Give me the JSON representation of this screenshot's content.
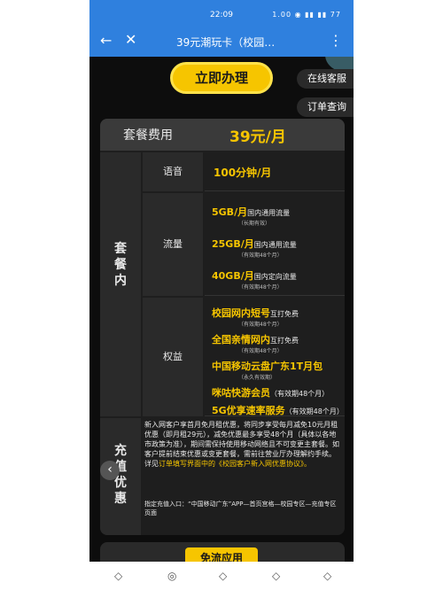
{
  "status_bar": {
    "time": "22:09",
    "icons": "1.00 ◉ ▮▮ ▮▮ 77"
  },
  "nav": {
    "back": "←",
    "close": "✕",
    "title": "39元潮玩卡（校园…",
    "more": "⋮"
  },
  "cta": {
    "label": "立即办理"
  },
  "side": {
    "service": "在线客服",
    "order": "订单查询"
  },
  "fee": {
    "label": "套餐费用",
    "price": "39元/月"
  },
  "package": {
    "label": "套餐内",
    "voice": {
      "label": "语音",
      "value": "100分钟/月"
    },
    "flow": {
      "label": "流量",
      "items": [
        {
          "main": "5GB/月",
          "desc": "国内通用流量",
          "note": "（长期有效）"
        },
        {
          "main": "25GB/月",
          "desc": "国内通用流量",
          "note": "（有效期48个月）"
        },
        {
          "main": "40GB/月",
          "desc": "国内定向流量",
          "note": "（有效期48个月）"
        }
      ]
    },
    "rights": {
      "label": "权益",
      "items": [
        {
          "main": "校园网内短号",
          "desc": "互打免费",
          "note": "（有效期48个月）"
        },
        {
          "main": "全国亲情网内",
          "desc": "互打免费",
          "note": "（有效期48个月）"
        },
        {
          "main": "中国移动云盘广东1T月包",
          "desc": "",
          "note": "（永久有效期）"
        },
        {
          "main": "咪咕快游会员",
          "desc": "（有效期48个月）",
          "note": ""
        },
        {
          "main": "5G优享速率服务",
          "desc": "（有效期48个月）",
          "note": ""
        }
      ]
    }
  },
  "charge": {
    "label": "充值优惠",
    "text_a": "新入网客户享首月免月租优惠，将同步享受每月减免10元月租优惠（即月租29元），减免优惠最多享受48个月（具体以各地市政策为准），期间需保持使用移动网络且不可变更主套餐。如客户提前结束优惠或变更套餐，需前往营业厅办理解约手续。详见",
    "text_hl": "订单填写界面中的《校园客户新入网优惠协议》。",
    "entry": "指定充值入口：“中国移动广东”APP—首页宫格—校园专区—充值专区页面"
  },
  "arrow": "‹",
  "bottom": {
    "label": "免流应用"
  },
  "system_nav": {
    "a": "◇",
    "b": "◎",
    "c": "◇",
    "d": "◇",
    "e": "◇"
  }
}
